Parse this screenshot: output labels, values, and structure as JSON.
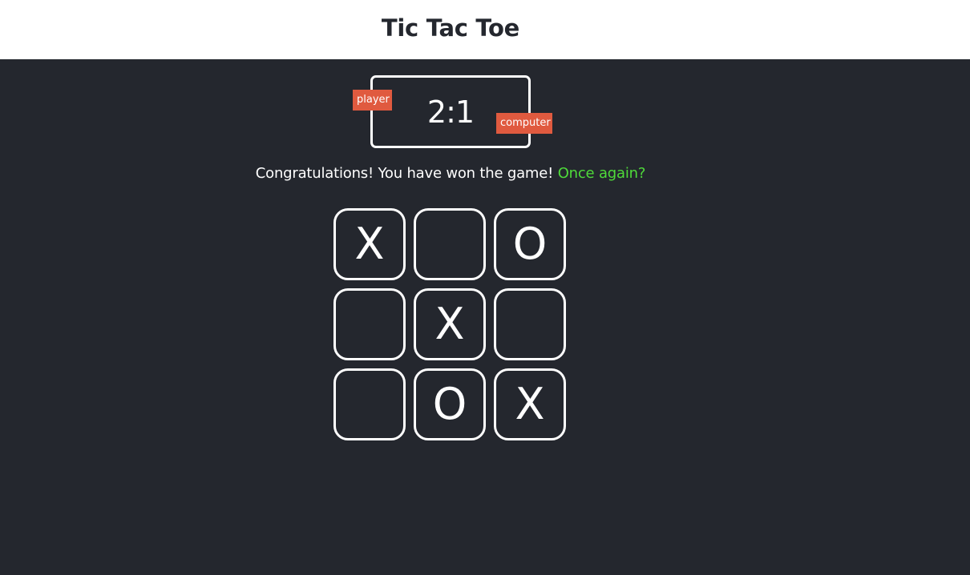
{
  "header": {
    "title": "Tic Tac Toe"
  },
  "scoreboard": {
    "score": "2:1",
    "player_label": "player",
    "computer_label": "computer"
  },
  "status": {
    "message": "Congratulations! You have won the game!",
    "again_link": "Once again?"
  },
  "board": {
    "cells": [
      "X",
      "",
      "O",
      "",
      "X",
      "",
      "",
      "O",
      "X"
    ]
  },
  "colors": {
    "background": "#24272e",
    "header": "#ffffff",
    "tag": "#e05a3f",
    "again_link": "#4fdb3a",
    "cell_border": "#ffffff"
  }
}
